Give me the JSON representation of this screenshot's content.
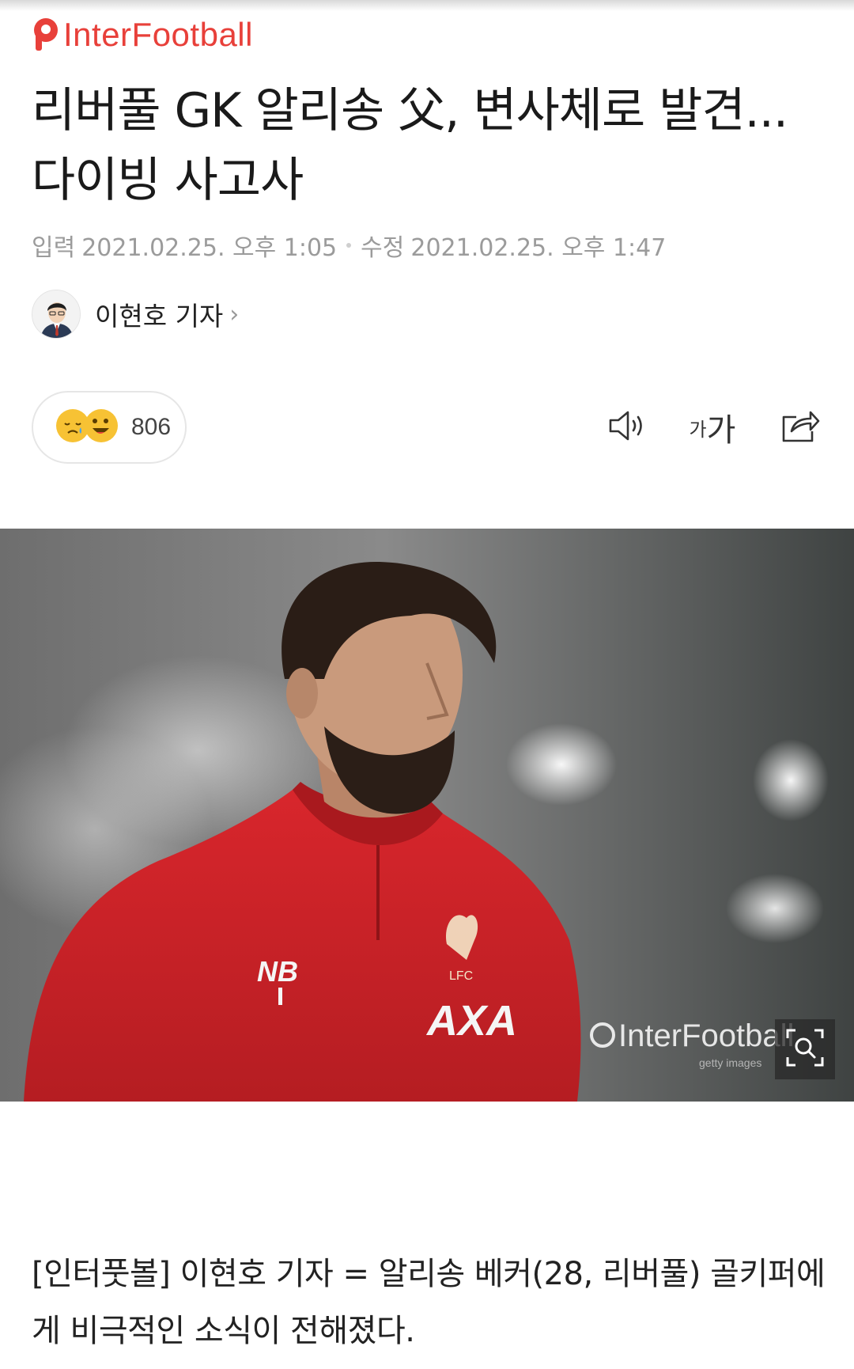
{
  "brand": {
    "logo_text": "InterFootball",
    "accent_color": "#e8403a"
  },
  "article": {
    "headline": "리버풀 GK 알리송 父, 변사체로 발견...다이빙 사고사",
    "published_label": "입력",
    "published_value": "2021.02.25. 오후 1:05",
    "modified_label": "수정",
    "modified_value": "2021.02.25. 오후 1:47",
    "author": "이현호 기자",
    "author_chevron": "›",
    "reaction_count": "806",
    "tools": {
      "speaker_icon": "speaker-icon",
      "font_small": "가",
      "font_big": "가",
      "share_icon": "share-icon"
    },
    "photo": {
      "watermark": "InterFootball",
      "subject": "Liverpool goalkeeper in red training top"
    },
    "body": "[인터풋볼] 이현호 기자 = 알리송 베커(28, 리버풀) 골키퍼에게 비극적인 소식이 전해졌다."
  }
}
